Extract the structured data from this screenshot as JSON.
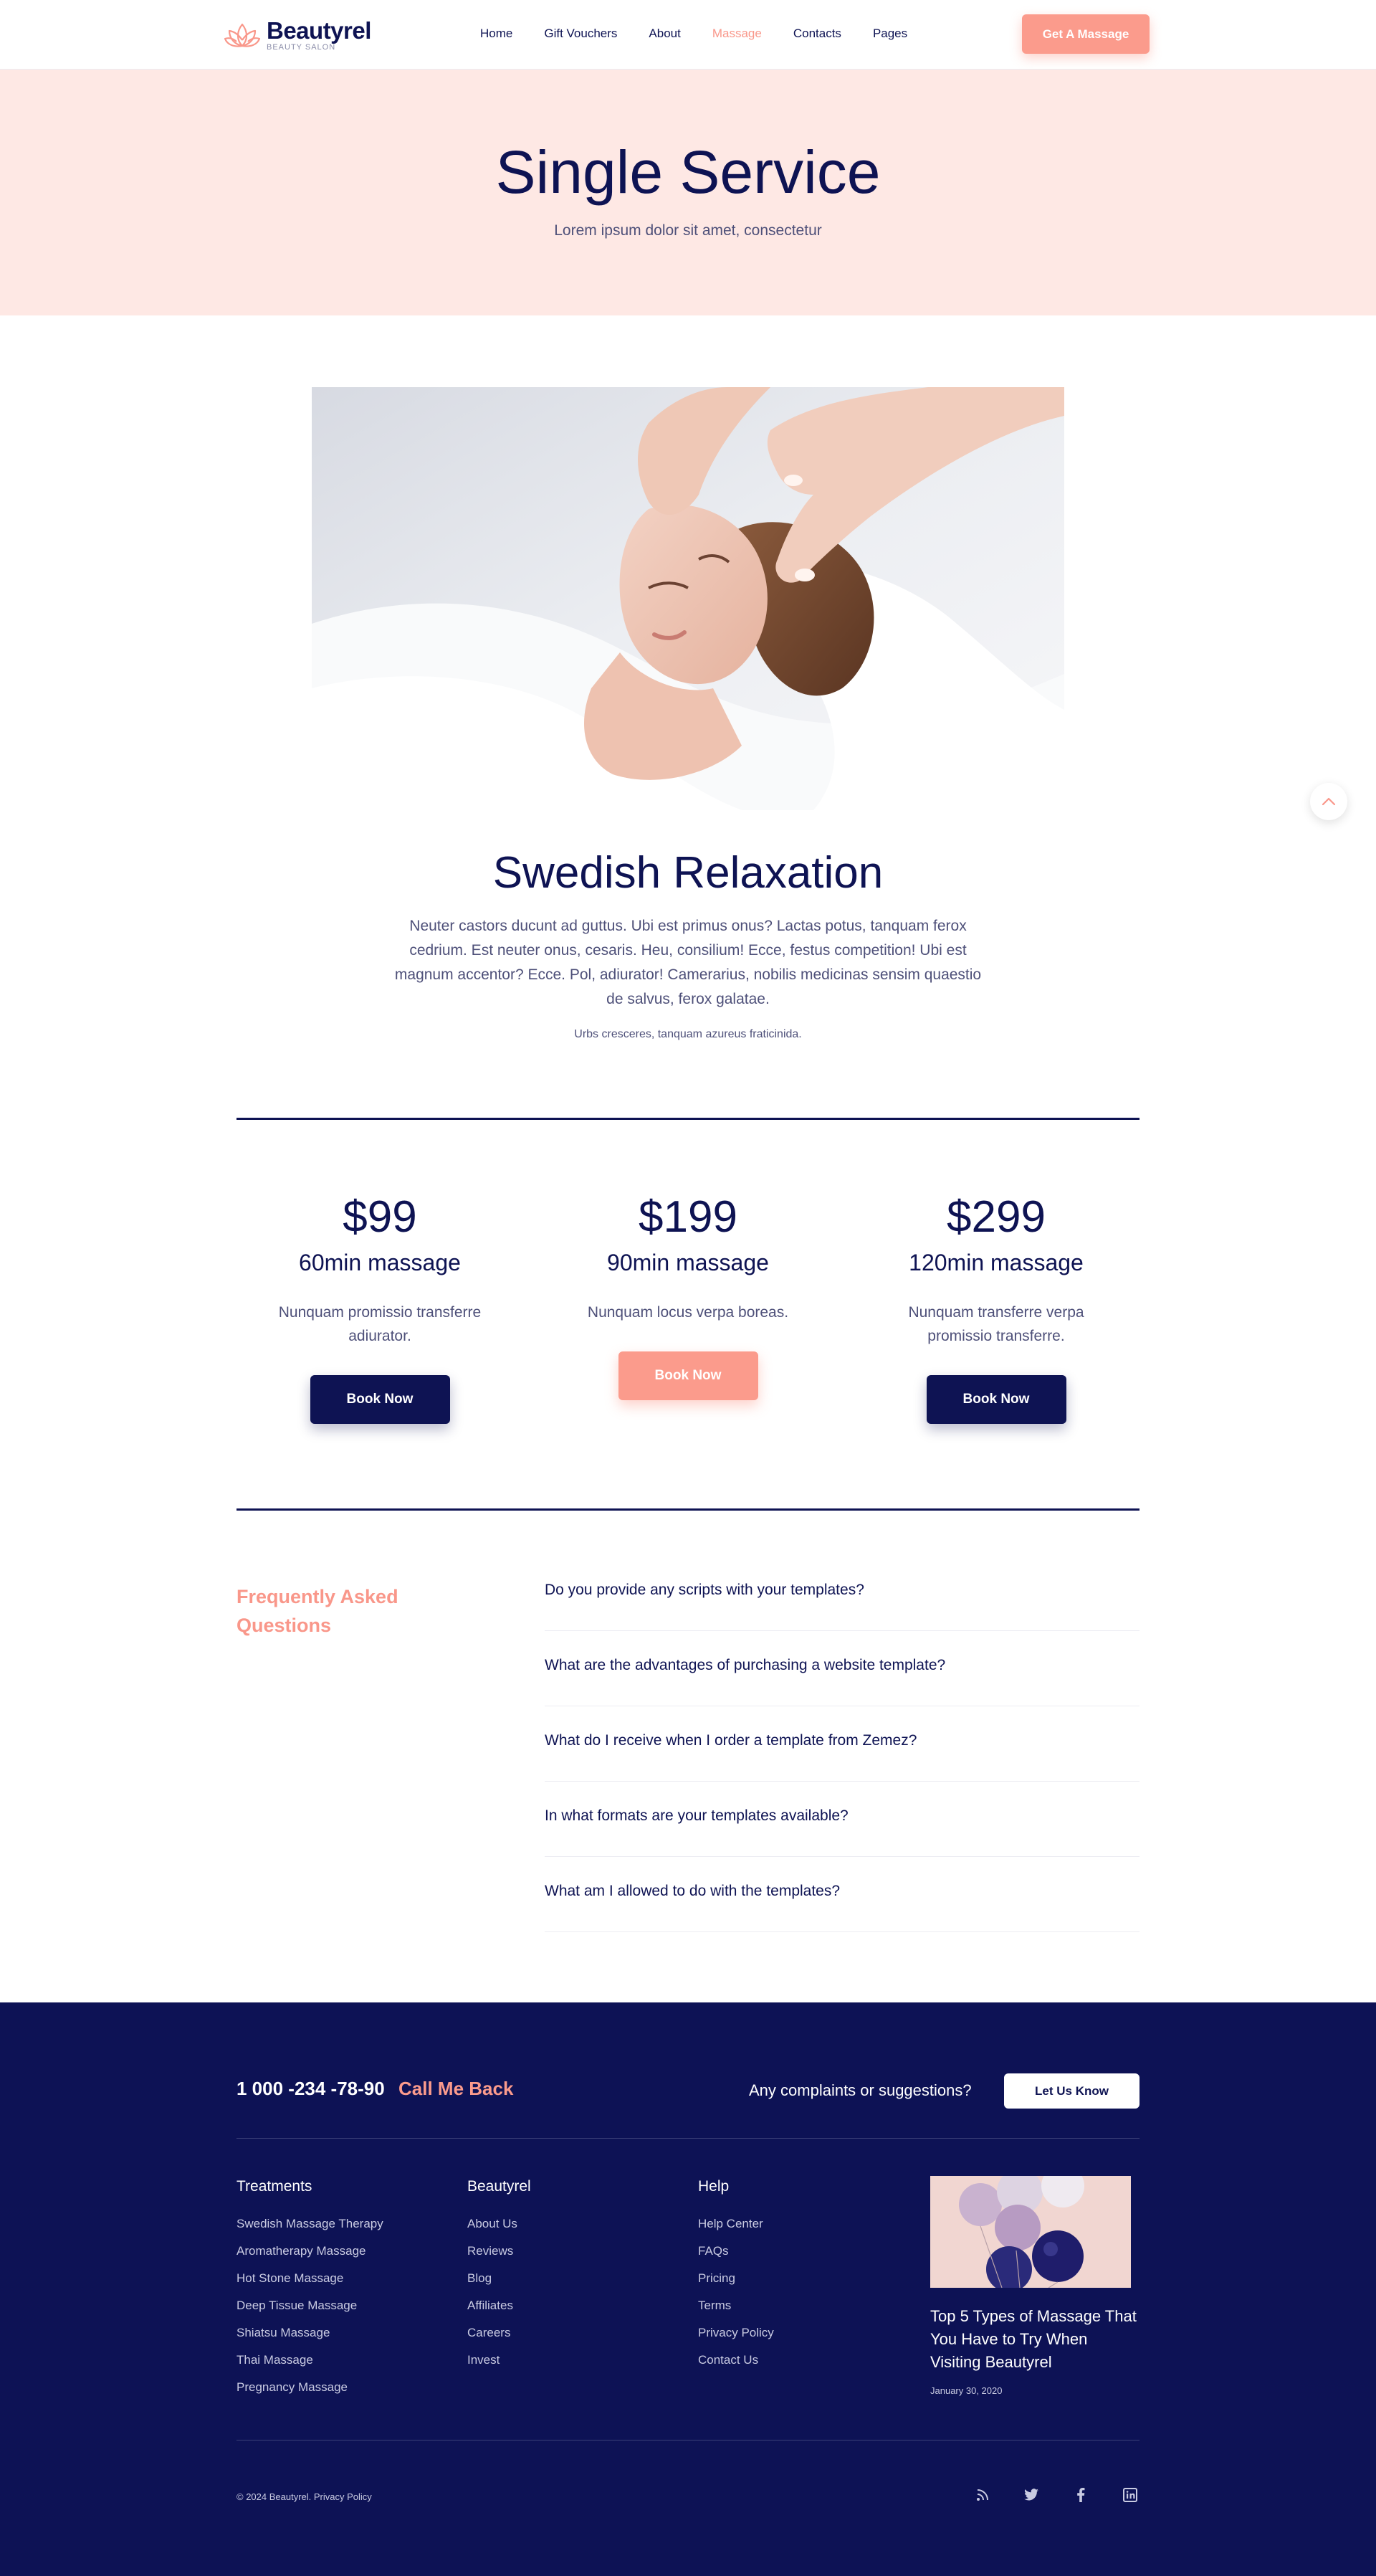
{
  "brand": {
    "name": "Beautyrel",
    "tagline": "BEAUTY SALON",
    "accent": "#fb9b8c",
    "navy": "#0e1353"
  },
  "nav": {
    "items": [
      {
        "label": "Home"
      },
      {
        "label": "Gift Vouchers"
      },
      {
        "label": "About"
      },
      {
        "label": "Massage",
        "active": true
      },
      {
        "label": "Contacts"
      },
      {
        "label": "Pages"
      }
    ],
    "cta": "Get A Massage"
  },
  "hero": {
    "title": "Single Service",
    "subtitle": "Lorem ipsum dolor sit amet, consectetur"
  },
  "service": {
    "title": "Swedish Relaxation",
    "description": "Neuter castors ducunt ad guttus. Ubi est primus onus? Lactas potus, tanquam ferox cedrium. Est neuter onus, cesaris. Heu, consilium! Ecce, festus competition! Ubi est magnum accentor? Ecce. Pol, adiurator! Camerarius, nobilis medicinas sensim quaestio de salvus, ferox galatae.",
    "note": "Urbs cresceres, tanquam azureus fraticinida."
  },
  "pricing": [
    {
      "price": "$99",
      "name": "60min massage",
      "desc": "Nunquam promissio transferre adiurator.",
      "button": "Book Now"
    },
    {
      "price": "$199",
      "name": "90min massage",
      "desc": "Nunquam locus verpa boreas.",
      "button": "Book Now"
    },
    {
      "price": "$299",
      "name": "120min massage",
      "desc": "Nunquam transferre verpa promissio transferre.",
      "button": "Book Now"
    }
  ],
  "faq": {
    "heading": "Frequently Asked Questions",
    "items": [
      "Do you provide any scripts with your templates?",
      "What are the advantages of purchasing a website template?",
      "What do I receive when I order a template from Zemez?",
      "In what formats are your templates available?",
      "What am I allowed to do with the templates?"
    ]
  },
  "footer": {
    "phone": "1 000 -234 -78-90",
    "call_back": "Call Me Back",
    "complaints": "Any complaints or suggestions?",
    "let_us_know": "Let Us Know",
    "columns": [
      {
        "title": "Treatments",
        "links": [
          "Swedish Massage Therapy",
          "Aromatherapy Massage",
          "Hot Stone Massage",
          "Deep Tissue Massage",
          "Shiatsu Massage",
          "Thai Massage",
          "Pregnancy Massage"
        ]
      },
      {
        "title": "Beautyrel",
        "links": [
          "About Us",
          "Reviews",
          "Blog",
          "Affiliates",
          "Careers",
          "Invest"
        ]
      },
      {
        "title": "Help",
        "links": [
          "Help Center",
          "FAQs",
          "Pricing",
          "Terms",
          "Privacy Policy",
          "Contact Us"
        ]
      }
    ],
    "post": {
      "title": "Top 5 Types of Massage That You Have to Try When Visiting Beautyrel",
      "date": "January 30, 2020"
    },
    "copyright": "©  2024 Beautyrel. Privacy Policy",
    "social": [
      "rss-icon",
      "twitter-icon",
      "facebook-icon",
      "linkedin-icon"
    ]
  }
}
